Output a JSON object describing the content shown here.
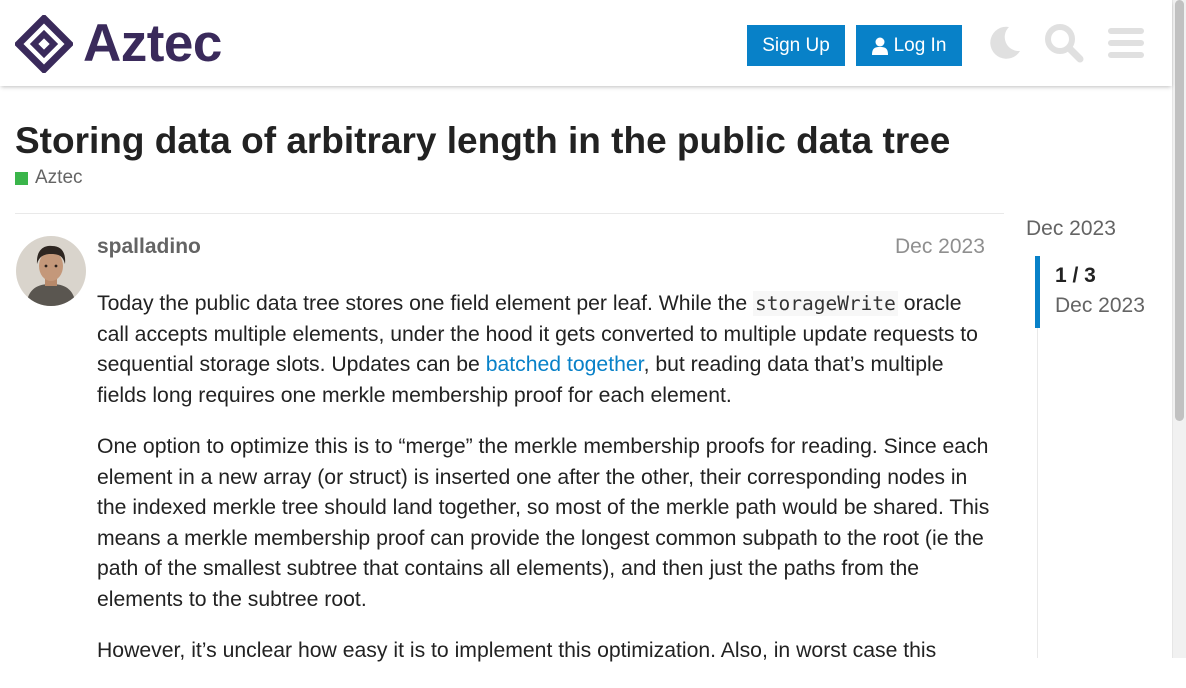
{
  "header": {
    "logo_text": "Aztec",
    "signup_label": "Sign Up",
    "login_label": "Log In",
    "icons": [
      "moon-icon",
      "search-icon",
      "hamburger-menu-icon"
    ],
    "accent_color": "#0881c8",
    "brand_color": "#3a2a5b"
  },
  "topic": {
    "title": "Storing data of arbitrary length in the public data tree",
    "category": "Aztec",
    "category_color": "#3ab54a"
  },
  "post": {
    "username": "spalladino",
    "date": "Dec 2023",
    "p1_a": "Today the public data tree stores one field element per leaf. While the ",
    "p1_code": "storageWrite",
    "p1_b": " oracle call accepts multiple elements, under the hood it gets converted to multiple update requests to sequential storage slots. Updates can be ",
    "p1_link": "batched together",
    "p1_c": ", but reading data that’s multiple fields long requires one merkle membership proof for each element.",
    "p2": "One option to optimize this is to “merge” the merkle membership proofs for reading. Since each element in a new array (or struct) is inserted one after the other, their corresponding nodes in the indexed merkle tree should land together, so most of the merkle path would be shared. This means a merkle membership proof can provide the longest common subpath to the root (ie the path of the smallest subtree that contains all elements), and then just the paths from the elements to the subtree root.",
    "p3": "However, it’s unclear how easy it is to implement this optimization. Also, in worst case this"
  },
  "timeline": {
    "top_date": "Dec 2023",
    "position": "1 / 3",
    "current_date": "Dec 2023",
    "progress_fraction": 0.33
  }
}
